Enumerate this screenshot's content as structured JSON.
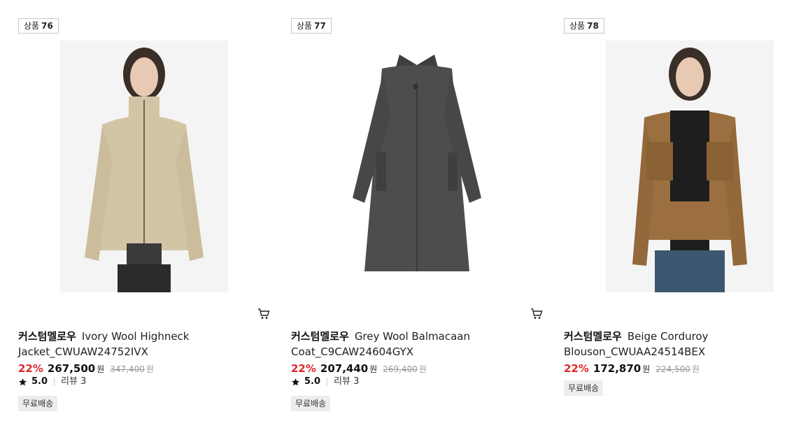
{
  "products": [
    {
      "badge_label": "상품",
      "badge_number": "76",
      "brand": "커스텀멜로우",
      "name": "Ivory Wool Highneck Jacket_CWUAW24752IVX",
      "discount": "22%",
      "price": "267,500",
      "currency": "원",
      "original_price": "347,400",
      "rating": "5.0",
      "review_label": "리뷰 3",
      "shipping": "무료배송",
      "image_desc_icon": "jacket-photo",
      "garment_color": "#d2c5a5"
    },
    {
      "badge_label": "상품",
      "badge_number": "77",
      "brand": "커스텀멜로우",
      "name": "Grey Wool Balmacaan Coat_C9CAW24604GYX",
      "discount": "22%",
      "price": "207,440",
      "currency": "원",
      "original_price": "269,400",
      "rating": "5.0",
      "review_label": "리뷰 3",
      "shipping": "무료배송",
      "image_desc_icon": "coat-photo",
      "garment_color": "#4d4d4d"
    },
    {
      "badge_label": "상품",
      "badge_number": "78",
      "brand": "커스텀멜로우",
      "name": "Beige Corduroy Blouson_CWUAA24514BEX",
      "discount": "22%",
      "price": "172,870",
      "currency": "원",
      "original_price": "224,500",
      "shipping": "무료배송",
      "image_desc_icon": "blouson-photo",
      "garment_color": "#9b6f3f"
    }
  ],
  "colors": {
    "discount": "#e0262b",
    "strike": "#9a9a9a",
    "ship_bg": "#ededed"
  }
}
